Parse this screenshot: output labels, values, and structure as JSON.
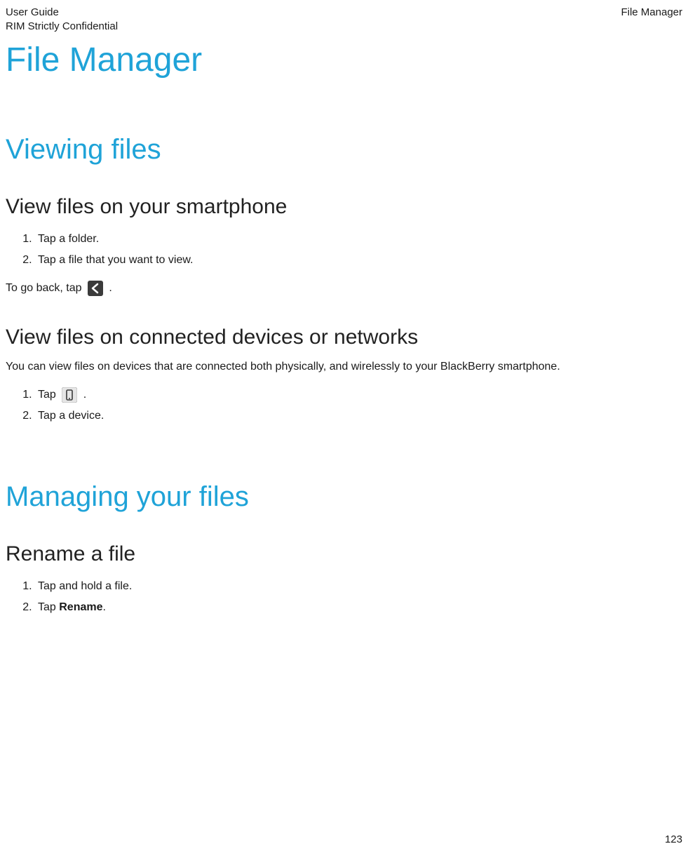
{
  "header": {
    "left_line1": "User Guide",
    "left_line2": "RIM Strictly Confidential",
    "right": "File Manager"
  },
  "title": "File Manager",
  "section1": {
    "heading": "Viewing files",
    "sub1": {
      "heading": "View files on your smartphone",
      "steps": [
        "Tap a folder.",
        "Tap a file that you want to view."
      ],
      "back_prefix": "To go back, tap ",
      "back_suffix": " ."
    },
    "sub2": {
      "heading": "View files on connected devices or networks",
      "intro": "You can view files on devices that are connected both physically, and wirelessly to your BlackBerry smartphone.",
      "step1_prefix": " Tap ",
      "step1_suffix": " .",
      "step2": "Tap a device."
    }
  },
  "section2": {
    "heading": "Managing your files",
    "sub1": {
      "heading": "Rename a file",
      "step1": "Tap and hold a file.",
      "step2_prefix": "Tap ",
      "step2_bold": "Rename",
      "step2_suffix": "."
    }
  },
  "page_number": "123",
  "icons": {
    "back": "back-icon",
    "device": "device-icon"
  }
}
